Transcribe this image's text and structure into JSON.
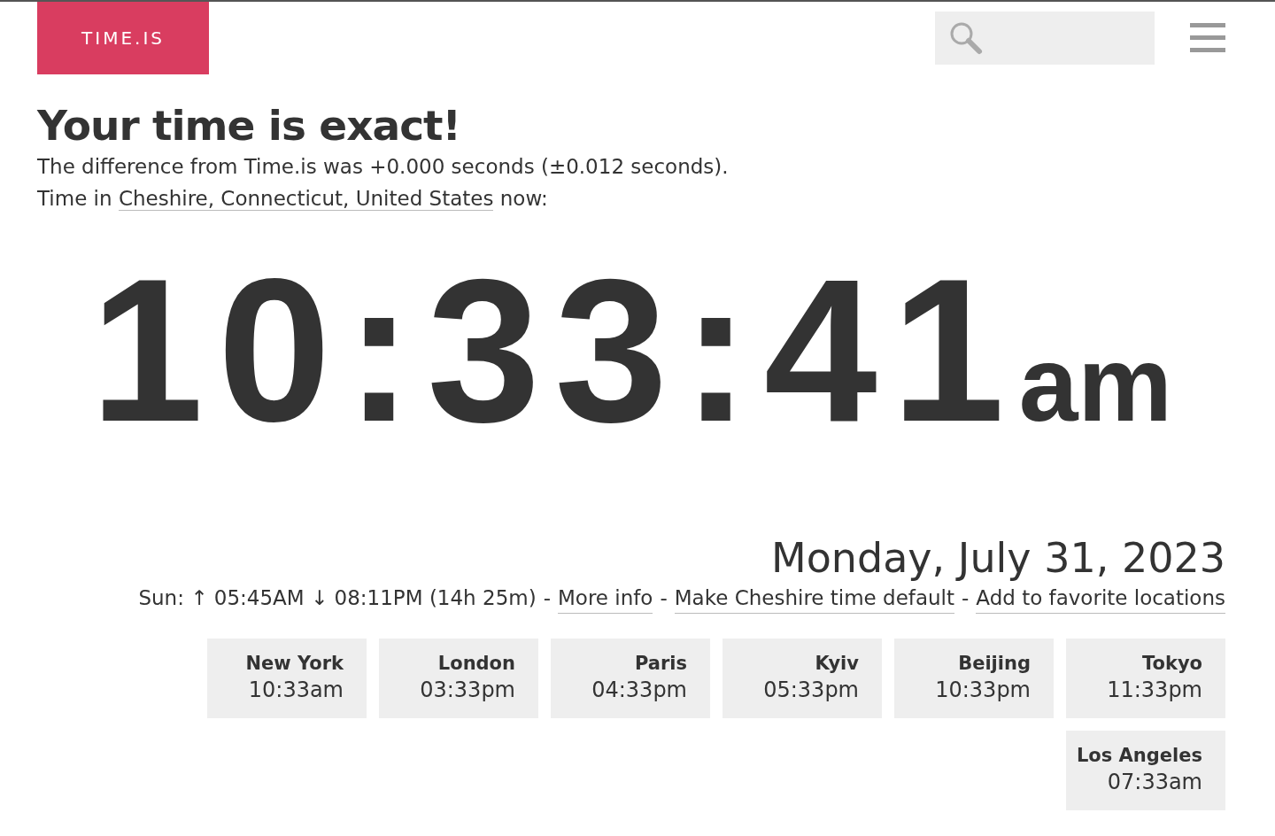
{
  "logo": "TIME.IS",
  "heading": "Your time is exact!",
  "difference": "The difference from Time.is was +0.000 seconds (±0.012 seconds).",
  "location_line": [
    {
      "kind": "text",
      "text": "Time in"
    },
    {
      "kind": "link",
      "text": "Cheshire, Connecticut, United States"
    },
    {
      "kind": "text",
      "text": "now:"
    }
  ],
  "clock": {
    "time": "10:33:41",
    "period": "am"
  },
  "date": "Monday, July 31, 2023",
  "sun_line": [
    {
      "kind": "text",
      "text": "Sun: ↑ 05:45AM ↓ 08:11PM (14h 25m)"
    },
    {
      "kind": "sep",
      "text": "-"
    },
    {
      "kind": "link",
      "text": "More info"
    },
    {
      "kind": "sep",
      "text": "-"
    },
    {
      "kind": "link",
      "text": "Make Cheshire time default"
    },
    {
      "kind": "sep",
      "text": "-"
    },
    {
      "kind": "link",
      "text": "Add to favorite locations"
    }
  ],
  "cities": [
    {
      "name": "New York",
      "time": "10:33am"
    },
    {
      "name": "London",
      "time": "03:33pm"
    },
    {
      "name": "Paris",
      "time": "04:33pm"
    },
    {
      "name": "Kyiv",
      "time": "05:33pm"
    },
    {
      "name": "Beijing",
      "time": "10:33pm"
    },
    {
      "name": "Tokyo",
      "time": "11:33pm"
    },
    {
      "name": "Los Angeles",
      "time": "07:33am"
    }
  ]
}
